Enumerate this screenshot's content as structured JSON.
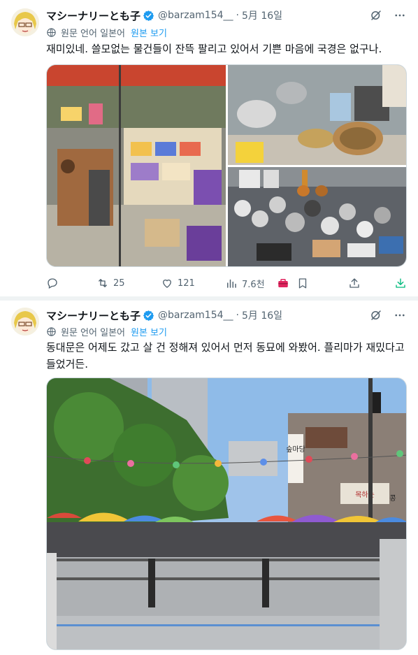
{
  "tweets": [
    {
      "author": {
        "name": "マシーナリーとも子",
        "handle": "@barzam154__"
      },
      "date": "5月 16일",
      "translation": {
        "note": "원문 언어 일본어",
        "link": "원본 보기"
      },
      "text": "재미있네. 쓸모없는 물건들이 잔뜩 팔리고 있어서 기쁜 마음에 국경은 없구나.",
      "stats": {
        "retweets": "25",
        "likes": "121",
        "views": "7.6천"
      }
    },
    {
      "author": {
        "name": "マシーナリーとも子",
        "handle": "@barzam154__"
      },
      "date": "5月 16일",
      "translation": {
        "note": "원문 언어 일본어",
        "link": "원본 보기"
      },
      "text": "동대문은 어제도 갔고 살 건 정해져 있어서 먼저 동묘에 와봤어. 플리마가 재밌다고 들었거든.",
      "photo_signs": [
        "숲마당",
        "목하는",
        "콩"
      ]
    }
  ],
  "icons": {
    "verified": "verified-badge-icon",
    "grok": "grok-icon",
    "more": "more-icon",
    "globe": "globe-icon",
    "reply": "reply-icon",
    "retweet": "retweet-icon",
    "like": "like-icon",
    "views": "views-icon",
    "tools": "toolbox-icon",
    "bookmark": "bookmark-icon",
    "share": "share-icon",
    "download": "download-icon"
  },
  "colors": {
    "accent": "#1d9bf0",
    "muted": "#536471",
    "download": "#00ba7c",
    "toolbox": "#e0245e"
  }
}
